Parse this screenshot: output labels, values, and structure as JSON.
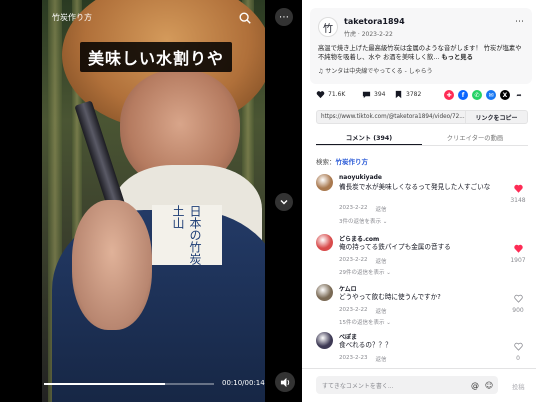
{
  "video": {
    "title": "竹炭作り方",
    "caption": "美味しい水割りや",
    "robe_text": "日本の竹炭 土山",
    "timecode": "00:10/00:14",
    "progress": 0.71
  },
  "post": {
    "avatar_glyph": "竹",
    "username": "taketora1894",
    "subline": "竹虎 · 2023-2-22",
    "description": "高温で焼き上げた最高級竹炭は金属のような音がします！ 竹炭が塩素や不純物を吸着し、水や お酒を美味しく飲...",
    "description_more": "もっと見る",
    "music": "♫ サンタは中央線でやってくる - しゃらう"
  },
  "actions": {
    "likes": "71.6K",
    "comments": "394",
    "saves": "3782"
  },
  "link": {
    "url": "https://www.tiktok.com/@taketora1894/video/72...",
    "copy_label": "リンクをコピー"
  },
  "tabs": [
    {
      "label": "コメント (394)"
    },
    {
      "label": "クリエイターの動画"
    }
  ],
  "search": {
    "prefix": "検索：",
    "keyword": "竹炭作り方"
  },
  "comments": [
    {
      "user": "naoyukiyade",
      "text": "備長炭で水が美味しくなるって発見した人すごいな",
      "date": "2023-2-22",
      "reply": "返信",
      "replies": "3件の返信を表示 ⌄",
      "likes": "3148",
      "liked": true,
      "avatar_color": "#a9794f"
    },
    {
      "user": "どらまる.com",
      "text": "俺の持ってる鉄パイプも金属の音する",
      "date": "2023-2-22",
      "reply": "返信",
      "replies": "29件の返信を表示 ⌄",
      "likes": "1907",
      "liked": true,
      "avatar_color": "#d84b4b"
    },
    {
      "user": "ケムロ",
      "text": "どうやって飲む時に使うんですか?",
      "date": "2023-2-22",
      "reply": "返信",
      "replies": "15件の返信を表示 ⌄",
      "likes": "900",
      "liked": false,
      "avatar_color": "#7a6a55"
    },
    {
      "user": "べぽま",
      "text": "食べれるの？？？",
      "date": "2023-2-23",
      "reply": "返信",
      "replies": "",
      "likes": "0",
      "liked": false,
      "avatar_color": "#3e3a55"
    }
  ],
  "bottom": {
    "placeholder": "すてきなコメントを書く...",
    "post_label": "投稿"
  },
  "colors": {
    "accent_red": "#fe2c55",
    "link_blue": "#2b5bd7"
  }
}
